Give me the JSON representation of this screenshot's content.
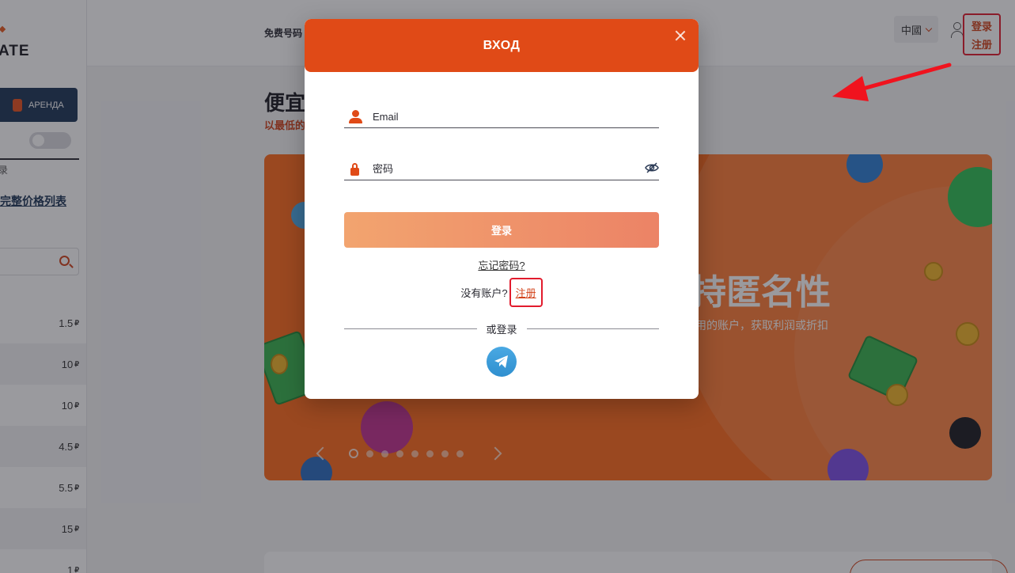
{
  "sidebar": {
    "logo_text": "ATE",
    "rent_label": "АРЕНДА",
    "small_text": "录",
    "price_list_link": "完整价格列表",
    "prices": [
      {
        "value": "1.5",
        "currency": "₽"
      },
      {
        "value": "10",
        "currency": "₽"
      },
      {
        "value": "10",
        "currency": "₽"
      },
      {
        "value": "4.5",
        "currency": "₽"
      },
      {
        "value": "5.5",
        "currency": "₽"
      },
      {
        "value": "15",
        "currency": "₽"
      },
      {
        "value": "1",
        "currency": "₽"
      }
    ]
  },
  "header": {
    "nav_free": "免费号码",
    "lang": "中國",
    "login_label": "登录",
    "register_label": "注册"
  },
  "main": {
    "heading": "便宜",
    "subheading": "以最低的",
    "banner_title": "持匿名性",
    "banner_desc": "用的账户，获取利润或折扣"
  },
  "modal": {
    "title": "ВХОД",
    "email_placeholder": "Email",
    "password_placeholder": "密码",
    "login_button": "登录",
    "forgot_link": "忘记密码?",
    "no_account_text": "没有账户?",
    "register_link": "注册",
    "or_login": "或登录"
  },
  "colors": {
    "accent": "#e04a17",
    "highlight_box": "#e21b2d",
    "banner": "#ff6a1a",
    "telegram": "#2f8fcf"
  }
}
